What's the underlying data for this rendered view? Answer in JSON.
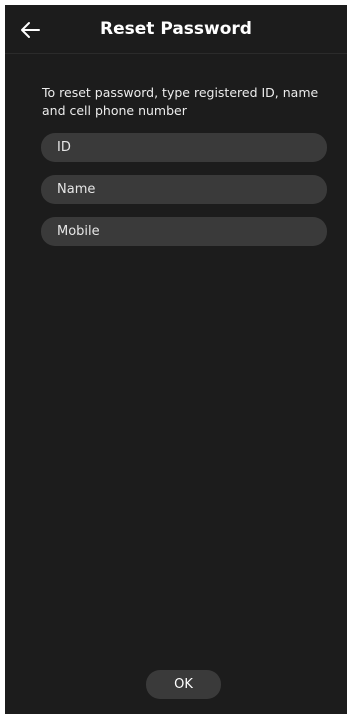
{
  "header": {
    "title": "Reset Password",
    "back_icon": "arrow-left-icon"
  },
  "instruction": "To reset password, type registered ID, name and cell phone number",
  "form": {
    "id_placeholder": "ID",
    "name_placeholder": "Name",
    "mobile_placeholder": "Mobile"
  },
  "actions": {
    "ok_label": "OK"
  },
  "colors": {
    "background": "#1c1c1c",
    "field_background": "#3a3a3a",
    "text": "#ffffff"
  }
}
